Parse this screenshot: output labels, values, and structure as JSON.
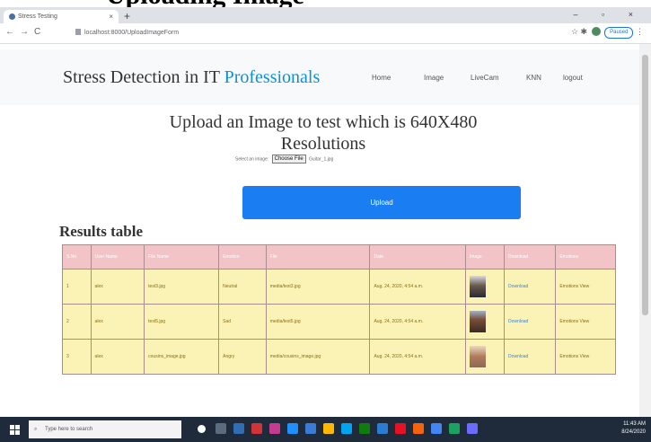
{
  "top_banner": "Uploading Image",
  "browser": {
    "tab_title": "Stress Testing",
    "tab_close": "×",
    "new_tab": "+",
    "url": "localhost:8000/UploadImageForm",
    "window_controls": "– ▫ ×",
    "profile_label": "Paused"
  },
  "navbar": {
    "brand_main": "Stress Detection in IT ",
    "brand_accent": "Professionals",
    "links": [
      "Home",
      "Image",
      "LiveCam",
      "KNN",
      "logout"
    ]
  },
  "upload": {
    "heading": "Upload an Image to test which is 640X480 Resolutions",
    "file_label": "Select an image:",
    "choose_file": "Choose File",
    "file_name": "Guitar_1.jpg",
    "button_label": "Upload"
  },
  "results": {
    "title": "Results table",
    "columns": [
      "S.No",
      "User Name",
      "File Name",
      "Emotion",
      "File",
      "Date",
      "Image",
      "Download",
      "Emotions"
    ],
    "rows": [
      {
        "sno": "1",
        "user": "alex",
        "file_name": "test3.jpg",
        "emotion": "Neutral",
        "file": "media/test3.jpg",
        "date": "Aug. 24, 2020, 4:54 a.m.",
        "download": "Download",
        "emotions": "Emotions View"
      },
      {
        "sno": "2",
        "user": "alex",
        "file_name": "test5.jpg",
        "emotion": "Sad",
        "file": "media/test5.jpg",
        "date": "Aug. 24, 2020, 4:54 a.m.",
        "download": "Download",
        "emotions": "Emotions View"
      },
      {
        "sno": "3",
        "user": "alex",
        "file_name": "cousins_image.jpg",
        "emotion": "Angry",
        "file": "media/cousins_image.jpg",
        "date": "Aug. 24, 2020, 4:54 a.m.",
        "download": "Download",
        "emotions": "Emotions View"
      }
    ]
  },
  "taskbar": {
    "search_placeholder": "Type here to search",
    "time": "11:43 AM",
    "date": "8/24/2020"
  },
  "colors": {
    "accent_blue": "#1a7ef2",
    "brand_accent": "#0d8fd6",
    "table_header": "#f2c4c8",
    "table_row": "#fbf3b6",
    "taskbar": "#1f2a3a"
  }
}
